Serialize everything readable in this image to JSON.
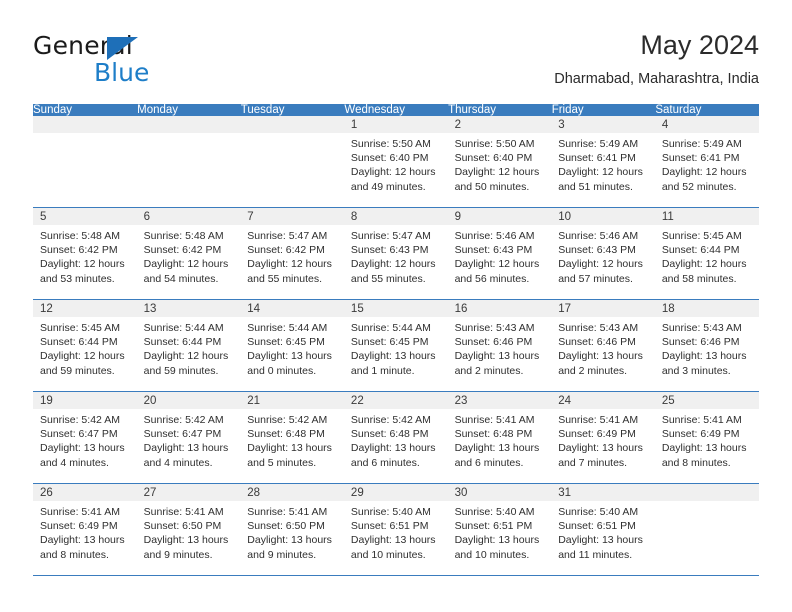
{
  "brand": {
    "name_part1": "General",
    "name_part2": "Blue",
    "logo_icon": "triangle-mark"
  },
  "header": {
    "title": "May 2024",
    "subtitle": "Dharmabad, Maharashtra, India"
  },
  "weekday_headers": [
    "Sunday",
    "Monday",
    "Tuesday",
    "Wednesday",
    "Thursday",
    "Friday",
    "Saturday"
  ],
  "colors": {
    "header_blue": "#3a7cbe",
    "brand_blue": "#1e7ec8",
    "day_band_gray": "#f0f0f0",
    "text": "#2f2f2f"
  },
  "labels": {
    "sunrise_prefix": "Sunrise:",
    "sunset_prefix": "Sunset:",
    "daylight_prefix": "Daylight:"
  },
  "weeks": [
    [
      {
        "day": "",
        "empty": true
      },
      {
        "day": "",
        "empty": true
      },
      {
        "day": "",
        "empty": true
      },
      {
        "day": "1",
        "sunrise": "Sunrise: 5:50 AM",
        "sunset": "Sunset: 6:40 PM",
        "daylight_line1": "Daylight: 12 hours",
        "daylight_line2": "and 49 minutes."
      },
      {
        "day": "2",
        "sunrise": "Sunrise: 5:50 AM",
        "sunset": "Sunset: 6:40 PM",
        "daylight_line1": "Daylight: 12 hours",
        "daylight_line2": "and 50 minutes."
      },
      {
        "day": "3",
        "sunrise": "Sunrise: 5:49 AM",
        "sunset": "Sunset: 6:41 PM",
        "daylight_line1": "Daylight: 12 hours",
        "daylight_line2": "and 51 minutes."
      },
      {
        "day": "4",
        "sunrise": "Sunrise: 5:49 AM",
        "sunset": "Sunset: 6:41 PM",
        "daylight_line1": "Daylight: 12 hours",
        "daylight_line2": "and 52 minutes."
      }
    ],
    [
      {
        "day": "5",
        "sunrise": "Sunrise: 5:48 AM",
        "sunset": "Sunset: 6:42 PM",
        "daylight_line1": "Daylight: 12 hours",
        "daylight_line2": "and 53 minutes."
      },
      {
        "day": "6",
        "sunrise": "Sunrise: 5:48 AM",
        "sunset": "Sunset: 6:42 PM",
        "daylight_line1": "Daylight: 12 hours",
        "daylight_line2": "and 54 minutes."
      },
      {
        "day": "7",
        "sunrise": "Sunrise: 5:47 AM",
        "sunset": "Sunset: 6:42 PM",
        "daylight_line1": "Daylight: 12 hours",
        "daylight_line2": "and 55 minutes."
      },
      {
        "day": "8",
        "sunrise": "Sunrise: 5:47 AM",
        "sunset": "Sunset: 6:43 PM",
        "daylight_line1": "Daylight: 12 hours",
        "daylight_line2": "and 55 minutes."
      },
      {
        "day": "9",
        "sunrise": "Sunrise: 5:46 AM",
        "sunset": "Sunset: 6:43 PM",
        "daylight_line1": "Daylight: 12 hours",
        "daylight_line2": "and 56 minutes."
      },
      {
        "day": "10",
        "sunrise": "Sunrise: 5:46 AM",
        "sunset": "Sunset: 6:43 PM",
        "daylight_line1": "Daylight: 12 hours",
        "daylight_line2": "and 57 minutes."
      },
      {
        "day": "11",
        "sunrise": "Sunrise: 5:45 AM",
        "sunset": "Sunset: 6:44 PM",
        "daylight_line1": "Daylight: 12 hours",
        "daylight_line2": "and 58 minutes."
      }
    ],
    [
      {
        "day": "12",
        "sunrise": "Sunrise: 5:45 AM",
        "sunset": "Sunset: 6:44 PM",
        "daylight_line1": "Daylight: 12 hours",
        "daylight_line2": "and 59 minutes."
      },
      {
        "day": "13",
        "sunrise": "Sunrise: 5:44 AM",
        "sunset": "Sunset: 6:44 PM",
        "daylight_line1": "Daylight: 12 hours",
        "daylight_line2": "and 59 minutes."
      },
      {
        "day": "14",
        "sunrise": "Sunrise: 5:44 AM",
        "sunset": "Sunset: 6:45 PM",
        "daylight_line1": "Daylight: 13 hours",
        "daylight_line2": "and 0 minutes."
      },
      {
        "day": "15",
        "sunrise": "Sunrise: 5:44 AM",
        "sunset": "Sunset: 6:45 PM",
        "daylight_line1": "Daylight: 13 hours",
        "daylight_line2": "and 1 minute."
      },
      {
        "day": "16",
        "sunrise": "Sunrise: 5:43 AM",
        "sunset": "Sunset: 6:46 PM",
        "daylight_line1": "Daylight: 13 hours",
        "daylight_line2": "and 2 minutes."
      },
      {
        "day": "17",
        "sunrise": "Sunrise: 5:43 AM",
        "sunset": "Sunset: 6:46 PM",
        "daylight_line1": "Daylight: 13 hours",
        "daylight_line2": "and 2 minutes."
      },
      {
        "day": "18",
        "sunrise": "Sunrise: 5:43 AM",
        "sunset": "Sunset: 6:46 PM",
        "daylight_line1": "Daylight: 13 hours",
        "daylight_line2": "and 3 minutes."
      }
    ],
    [
      {
        "day": "19",
        "sunrise": "Sunrise: 5:42 AM",
        "sunset": "Sunset: 6:47 PM",
        "daylight_line1": "Daylight: 13 hours",
        "daylight_line2": "and 4 minutes."
      },
      {
        "day": "20",
        "sunrise": "Sunrise: 5:42 AM",
        "sunset": "Sunset: 6:47 PM",
        "daylight_line1": "Daylight: 13 hours",
        "daylight_line2": "and 4 minutes."
      },
      {
        "day": "21",
        "sunrise": "Sunrise: 5:42 AM",
        "sunset": "Sunset: 6:48 PM",
        "daylight_line1": "Daylight: 13 hours",
        "daylight_line2": "and 5 minutes."
      },
      {
        "day": "22",
        "sunrise": "Sunrise: 5:42 AM",
        "sunset": "Sunset: 6:48 PM",
        "daylight_line1": "Daylight: 13 hours",
        "daylight_line2": "and 6 minutes."
      },
      {
        "day": "23",
        "sunrise": "Sunrise: 5:41 AM",
        "sunset": "Sunset: 6:48 PM",
        "daylight_line1": "Daylight: 13 hours",
        "daylight_line2": "and 6 minutes."
      },
      {
        "day": "24",
        "sunrise": "Sunrise: 5:41 AM",
        "sunset": "Sunset: 6:49 PM",
        "daylight_line1": "Daylight: 13 hours",
        "daylight_line2": "and 7 minutes."
      },
      {
        "day": "25",
        "sunrise": "Sunrise: 5:41 AM",
        "sunset": "Sunset: 6:49 PM",
        "daylight_line1": "Daylight: 13 hours",
        "daylight_line2": "and 8 minutes."
      }
    ],
    [
      {
        "day": "26",
        "sunrise": "Sunrise: 5:41 AM",
        "sunset": "Sunset: 6:49 PM",
        "daylight_line1": "Daylight: 13 hours",
        "daylight_line2": "and 8 minutes."
      },
      {
        "day": "27",
        "sunrise": "Sunrise: 5:41 AM",
        "sunset": "Sunset: 6:50 PM",
        "daylight_line1": "Daylight: 13 hours",
        "daylight_line2": "and 9 minutes."
      },
      {
        "day": "28",
        "sunrise": "Sunrise: 5:41 AM",
        "sunset": "Sunset: 6:50 PM",
        "daylight_line1": "Daylight: 13 hours",
        "daylight_line2": "and 9 minutes."
      },
      {
        "day": "29",
        "sunrise": "Sunrise: 5:40 AM",
        "sunset": "Sunset: 6:51 PM",
        "daylight_line1": "Daylight: 13 hours",
        "daylight_line2": "and 10 minutes."
      },
      {
        "day": "30",
        "sunrise": "Sunrise: 5:40 AM",
        "sunset": "Sunset: 6:51 PM",
        "daylight_line1": "Daylight: 13 hours",
        "daylight_line2": "and 10 minutes."
      },
      {
        "day": "31",
        "sunrise": "Sunrise: 5:40 AM",
        "sunset": "Sunset: 6:51 PM",
        "daylight_line1": "Daylight: 13 hours",
        "daylight_line2": "and 11 minutes."
      },
      {
        "day": "",
        "empty": true
      }
    ]
  ]
}
